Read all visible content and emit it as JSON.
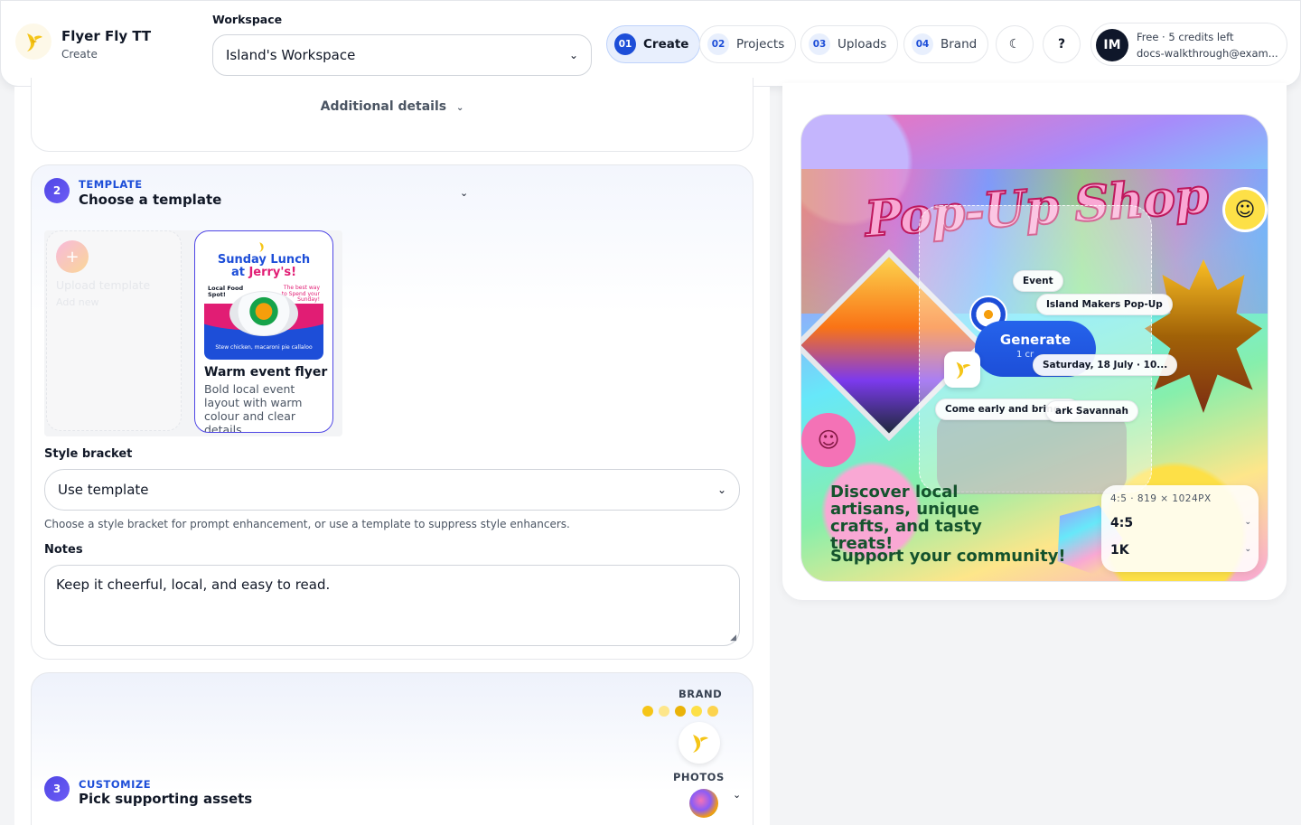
{
  "header": {
    "app_name": "Flyer Fly TT",
    "app_section": "Create",
    "workspace_label": "Workspace",
    "workspace_value": "Island's Workspace",
    "nav": [
      {
        "num": "01",
        "label": "Create",
        "active": true
      },
      {
        "num": "02",
        "label": "Projects",
        "active": false
      },
      {
        "num": "03",
        "label": "Uploads",
        "active": false
      },
      {
        "num": "04",
        "label": "Brand",
        "active": false
      }
    ],
    "theme_toggle_glyph": "☾",
    "help_glyph": "?",
    "account": {
      "initials": "IM",
      "plan": "Free · 5 credits left",
      "email": "docs-walkthrough@exam..."
    }
  },
  "additional_details": {
    "label": "Additional details"
  },
  "template_step": {
    "number": "2",
    "kicker": "TEMPLATE",
    "title": "Choose a template",
    "upload_card": {
      "title": "Upload template",
      "subtitle": "Add new",
      "plus": "+"
    },
    "template_card": {
      "thumb_title_1": "Sunday Lunch",
      "thumb_title_2a": "at ",
      "thumb_title_2b": "Jerry's!",
      "thumb_left": "Local Food Spot!",
      "thumb_right": "The best way to Spend your Sunday!",
      "thumb_caption": "Stew chicken, macaroni pie callaloo",
      "name": "Warm event flyer",
      "description": "Bold local event layout with warm colour and clear details"
    },
    "style_bracket": {
      "label": "Style bracket",
      "value": "Use template",
      "helper": "Choose a style bracket for prompt enhancement, or use a template to suppress style enhancers."
    },
    "notes": {
      "label": "Notes",
      "value": "Keep it cheerful, local, and easy to read."
    }
  },
  "customize_step": {
    "number": "3",
    "kicker": "CUSTOMIZE",
    "title": "Pick supporting assets",
    "brand_label": "BRAND",
    "photos_label": "PHOTOS",
    "brand_colors": [
      "#f5c518",
      "#fde68a",
      "#eab308",
      "#fde047",
      "#fcd34d"
    ]
  },
  "preview": {
    "headline": "Pop-Up Shop",
    "chips": {
      "event": "Event",
      "event_name": "Island Makers Pop-Up",
      "date": "Saturday, 18 July · 10...",
      "come_early": "Come early and bring a",
      "location": "ark Savannah"
    },
    "generate_label": "Generate",
    "generate_sub": "1 cr",
    "copy_lines": "Discover local artisans, unique crafts, and tasty treats!",
    "copy_support": "Support your community!",
    "size_readout": "4:5 · 819 × 1024PX",
    "aspect_ratio": "4:5",
    "resolution": "1K"
  },
  "icons": {
    "logo": "bird-logo-icon",
    "chevron": "chevron-down-icon",
    "smiley": "smiley-icon"
  },
  "colors": {
    "accent": "#1d4ed8",
    "step_badge": "#4f46e5",
    "logo_yellow": "#f5c518"
  }
}
